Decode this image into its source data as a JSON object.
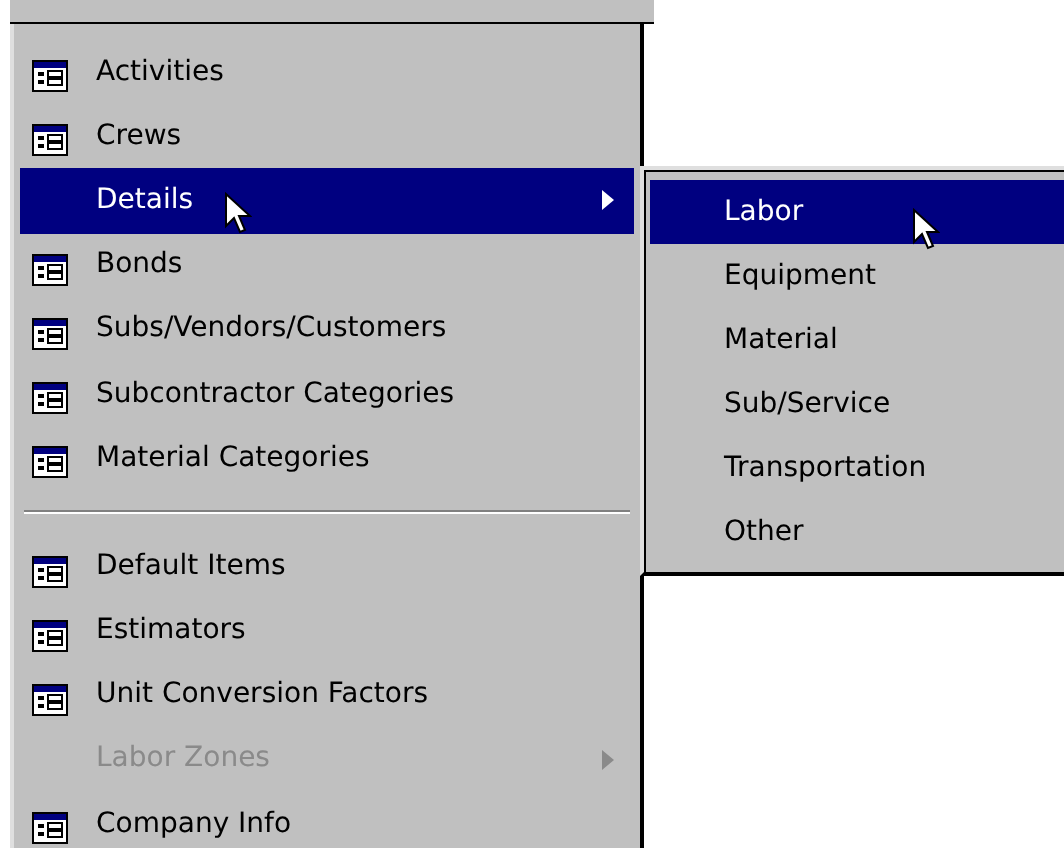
{
  "menu": {
    "items": [
      {
        "kind": "item",
        "label": "Activities",
        "icon": true,
        "submenu": false,
        "disabled": false,
        "selected": false
      },
      {
        "kind": "item",
        "label": "Crews",
        "icon": true,
        "submenu": false,
        "disabled": false,
        "selected": false
      },
      {
        "kind": "item",
        "label": "Details",
        "icon": false,
        "submenu": true,
        "disabled": false,
        "selected": true
      },
      {
        "kind": "item",
        "label": "Bonds",
        "icon": true,
        "submenu": false,
        "disabled": false,
        "selected": false
      },
      {
        "kind": "item",
        "label": "Subs/Vendors/Customers",
        "icon": true,
        "submenu": false,
        "disabled": false,
        "selected": false
      },
      {
        "kind": "item",
        "label": "Subcontractor Categories",
        "icon": true,
        "submenu": false,
        "disabled": false,
        "selected": false
      },
      {
        "kind": "item",
        "label": "Material Categories",
        "icon": true,
        "submenu": false,
        "disabled": false,
        "selected": false
      },
      {
        "kind": "separator"
      },
      {
        "kind": "item",
        "label": "Default Items",
        "icon": true,
        "submenu": false,
        "disabled": false,
        "selected": false
      },
      {
        "kind": "item",
        "label": "Estimators",
        "icon": true,
        "submenu": false,
        "disabled": false,
        "selected": false
      },
      {
        "kind": "item",
        "label": "Unit Conversion Factors",
        "icon": true,
        "submenu": false,
        "disabled": false,
        "selected": false
      },
      {
        "kind": "item",
        "label": "Labor Zones",
        "icon": false,
        "submenu": true,
        "disabled": true,
        "selected": false
      },
      {
        "kind": "item",
        "label": "Company Info",
        "icon": true,
        "submenu": false,
        "disabled": false,
        "selected": false
      }
    ]
  },
  "submenu": {
    "items": [
      {
        "label": "Labor",
        "selected": true
      },
      {
        "label": "Equipment",
        "selected": false
      },
      {
        "label": "Material",
        "selected": false
      },
      {
        "label": "Sub/Service",
        "selected": false
      },
      {
        "label": "Transportation",
        "selected": false
      },
      {
        "label": "Other",
        "selected": false
      }
    ]
  }
}
